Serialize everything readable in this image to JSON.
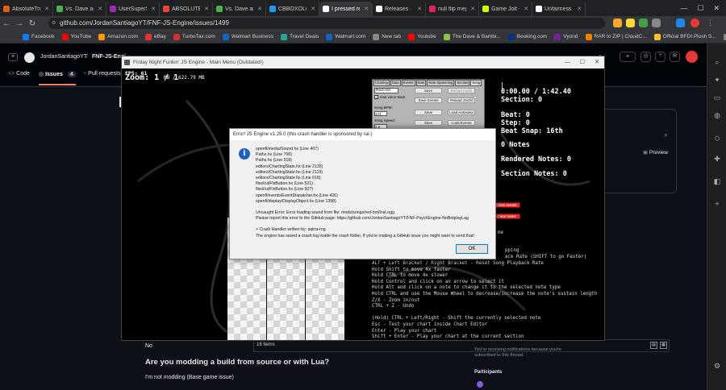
{
  "tabs": [
    {
      "label": "AbsoluteTrueli...",
      "color": "#e36209",
      "active": false
    },
    {
      "label": "Vs. Dave and B...",
      "color": "#4caf50",
      "active": false
    },
    {
      "label": "UserSuperSon...",
      "color": "#9c27b0",
      "active": false
    },
    {
      "label": "ABSOLUTE Y...",
      "color": "#f44336",
      "active": false
    },
    {
      "label": "Vs. Dave and B...",
      "color": "#4caf50",
      "active": false
    },
    {
      "label": "CBBOXOLOG...",
      "color": "#2196f3",
      "active": false
    },
    {
      "label": "I pressed relo...",
      "color": "#ffffff",
      "active": true
    },
    {
      "label": "Releases · Jord...",
      "color": "#ffffff",
      "active": false
    },
    {
      "label": "null flip megan...",
      "color": "#e91e63",
      "active": false
    },
    {
      "label": "Game Jolt - Sh...",
      "color": "#ccff00",
      "active": false
    },
    {
      "label": "Unfairness - Gi...",
      "color": "#ffffff",
      "active": false
    }
  ],
  "address": {
    "url": "github.com/JordanSantiagoYT/FNF-JS-Engine/issues/1499"
  },
  "bookmarks": [
    "Facebook",
    "YouTube",
    "Amazon.com",
    "eBay",
    "TurboTax.com",
    "Walmart Business",
    "Travel Deals",
    "Walmart.com",
    "New tab",
    "Youtube",
    "The Dave & Bambi...",
    "Booking.com",
    "Vyond",
    "RAR to ZIP | CloudC...",
    "Official BFDI Plush S...",
    "All Bookmarks"
  ],
  "github": {
    "owner": "JordanSantiagoYT",
    "repo": "FNF-JS-Engi...",
    "nav": {
      "code": "Code",
      "issues": "Issues",
      "issues_count": "4",
      "pulls": "Pull requests"
    },
    "preview": "Preview",
    "no_label": "No",
    "question": "Are you modding a build from source or with Lua?",
    "answer": "I'm not modding (Base game issue)",
    "items_count": "16 items",
    "notify_text": "You're receiving notifications because you're subscribed to this thread.",
    "participants": "Participants"
  },
  "game": {
    "window_title": "Friday Night Funkin' JS Engine - Main Menu (Outdated!)",
    "fps": "FPS: 61",
    "zoom": "Zoom: 1 / 1",
    "memory": "MB / 622.79 MB",
    "tabs": [
      "Charting",
      "Data",
      "Events",
      "Note",
      "Note Spamming",
      "Section",
      "Song"
    ],
    "song_name": "Red-Hot",
    "voice_track": "Has voice track",
    "song_bpm_label": "Song BPM:",
    "song_bpm": "174",
    "song_speed_label": "Song Speed:",
    "song_speed": "1.5",
    "buttons": [
      "Save",
      "Reload Audio",
      "Save Events",
      "Reload JSON",
      "Save",
      "Load Autosave",
      "Save",
      "Load Events"
    ],
    "clear_buttons": [
      "Clear events",
      "Clear notes"
    ],
    "time": "0:00.00 / 1:42.40",
    "section": "Section: 0",
    "beat": "Beat: 0",
    "step": "Step: 0",
    "beat_snap": "Beat Snap: 16th",
    "notes": "0 Notes",
    "rendered_notes": "Rendered Notes: 0",
    "section_notes": "Section Notes: 0",
    "help_lines": [
      "ALT + Left Bracket / Right Bracket - Reset Song Playback Rate",
      "Hold Shift to move 4x faster",
      "Hold CTRL to move 4x slower",
      "Hold Control and click on an arrow to select it",
      "Hold Alt and click on a note to change it to the selected note type",
      "Hold CTRL and use the Mouse Wheel to decrease/increase the note's sustain length",
      "Z/X - Zoom in/out",
      "CTRL + Z - Undo",
      "",
      "(Hold) CTRL + Left/Right - Shift the currently selected note",
      "Esc - Test your chart inside Chart Editor",
      "Enter - Play your chart",
      "Shift + Enter - Play your chart at the current section"
    ],
    "partial_lines": [
      "pping",
      "ack Rate (SHIFT to go Faster)",
      "me"
    ]
  },
  "dialog": {
    "title": "Error! JS Engine v1.29.0 (this crash handler is sponsored by rai-)",
    "stack": [
      "openfl/media/Sound.hx (Line 407)",
      "Paths.hx (Line 700)",
      "Paths.hx (Line 518)",
      "editors/ChartingState.hx (Line 2135)",
      "editors/ChartingState.hx (Line 2119)",
      "editors/ChartingState.hx (Line 618)",
      "flixel/ui/FlxButton.hx (Line 521)",
      "flixel/ui/FlxButton.hx (Line 507)",
      "openfl/events/EventDispatcher.hx (Line 426)",
      "openfl/display/DisplayObject.hx (Line 1398)"
    ],
    "error": "Uncaught Error: Error loading sound from file: mods/songs/red-hot/Inst.ogg",
    "report": "Please report this error to the GitHub page: https://github.com/JordanSantiagoYT/FNF-PsychEngine-NoBotplayLag",
    "handler": "> Crash Handler written by: sqirra-rng",
    "saved": "The engine has saved a crash log inside the crash folder, If you're making a GitHub issue you might want to send that!",
    "ok": "OK"
  }
}
